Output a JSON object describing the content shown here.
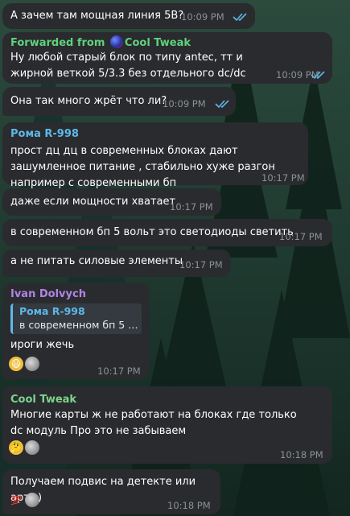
{
  "colors": {
    "bubble": "#2a2b2e",
    "time": "#8a9296",
    "read_ticks": "#5fb6ea",
    "forwarded_name": "#5fd27c",
    "roma_name": "#5eb8ea",
    "ivan_name": "#b084e6",
    "cool_name": "#7bd48c"
  },
  "messages": [
    {
      "text": "А зачем там мощная линия 5В?",
      "time": "10:09 PM",
      "status": "read-double-check-icon"
    },
    {
      "forwarded_label": "Forwarded from",
      "forwarded_from": "Cool Tweak",
      "text": "Ну любой старый блок по типу antec, тт и жирной веткой 5/3.3 без отдельного dc/dc",
      "time": "10:09 PM",
      "status": "read-double-check-icon"
    },
    {
      "text": "Она так много жрёт что ли?",
      "time": "10:09 PM",
      "status": "read-double-check-icon"
    },
    {
      "sender": "Рома R-998",
      "text": "прост дц дц в современных блоках дают зашумленное питание , стабильно хуже разгон например с современными бп",
      "time": "10:17 PM"
    },
    {
      "text": "даже если мощности хватает",
      "time": "10:17 PM"
    },
    {
      "text": "в современном бп 5 вольт это светодиоды светить",
      "time": "10:17 PM"
    },
    {
      "text": "а не питать силовые элементы",
      "time": "10:17 PM"
    },
    {
      "sender": "Ivan Dolvych",
      "reply": {
        "name": "Рома R-998",
        "text": "в современном бп 5 …"
      },
      "text": "ироги жечь",
      "reactions": [
        "grinning-face-emoji",
        "user-avatar"
      ],
      "time": "10:17 PM"
    },
    {
      "sender": "Cool Tweak",
      "text": "Многие карты ж не работают на блоках где только dc модуль Про это не забываем",
      "reactions": [
        "thinking-face-emoji",
        "user-avatar"
      ],
      "time": "10:18 PM"
    },
    {
      "text": "Получаем подвис на детекте или арты)",
      "reactions": [
        "hundred-points-emoji",
        "user-avatar"
      ],
      "time": "10:18 PM"
    }
  ]
}
